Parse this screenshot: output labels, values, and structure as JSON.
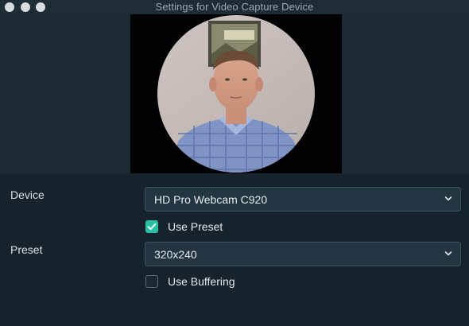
{
  "window": {
    "title": "Settings for Video Capture Device"
  },
  "preview": {
    "shape": "circle",
    "content": "webcam-video-preview"
  },
  "device": {
    "label": "Device",
    "value": "HD Pro Webcam C920"
  },
  "use_preset": {
    "label": "Use Preset",
    "checked": true
  },
  "preset": {
    "label": "Preset",
    "value": "320x240"
  },
  "use_buffering": {
    "label": "Use Buffering",
    "checked": false
  },
  "colors": {
    "accent": "#25c0a2",
    "background": "#1c2a34",
    "panel": "#16232c",
    "select_bg": "#233540"
  },
  "icons": {
    "chevron": "chevron-down-icon",
    "checkmark": "checkmark-icon"
  }
}
